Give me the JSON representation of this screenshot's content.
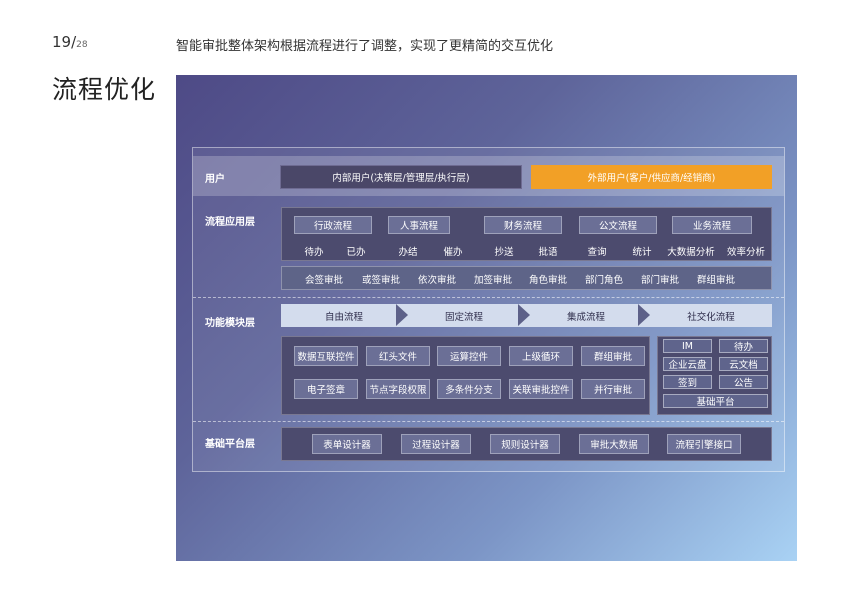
{
  "header": {
    "page_current": "19/",
    "page_total": "28",
    "subtitle": "智能审批整体架构根据流程进行了调整，实现了更精简的交互优化",
    "title": "流程优化"
  },
  "diagram": {
    "layers": {
      "user": "用户",
      "process_app": "流程应用层",
      "function_module": "功能模块层",
      "base_platform": "基础平台层"
    },
    "users": {
      "internal": "内部用户(决策层/管理层/执行层)",
      "external": "外部用户(客户/供应商/经销商)"
    },
    "process_types": [
      "行政流程",
      "人事流程",
      "财务流程",
      "公文流程",
      "业务流程"
    ],
    "process_actions": [
      "待办",
      "已办",
      "办结",
      "催办",
      "抄送",
      "批语",
      "查询",
      "统计",
      "大数据分析",
      "效率分析"
    ],
    "approval_types": [
      "会签审批",
      "或签审批",
      "依次审批",
      "加签审批",
      "角色审批",
      "部门角色",
      "部门审批",
      "群组审批"
    ],
    "flow_stages": [
      "自由流程",
      "固定流程",
      "集成流程",
      "社交化流程"
    ],
    "modules_row1": [
      "数据互联控件",
      "红头文件",
      "运算控件",
      "上级循环",
      "群组审批"
    ],
    "modules_row2": [
      "电子签章",
      "节点字段权限",
      "多条件分支",
      "关联审批控件",
      "并行审批"
    ],
    "platform_items": [
      "IM",
      "待办",
      "企业云盘",
      "云文档",
      "签到",
      "公告",
      "基础平台"
    ],
    "designers": [
      "表单设计器",
      "过程设计器",
      "规则设计器",
      "审批大数据",
      "流程引擎接口"
    ]
  }
}
